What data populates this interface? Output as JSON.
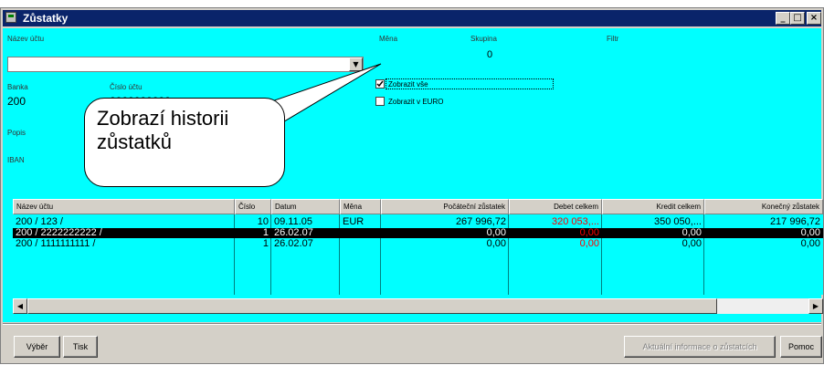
{
  "window": {
    "title": "Zůstatky",
    "controls": {
      "minimize": "_",
      "maximize": "□",
      "close": "×"
    }
  },
  "form": {
    "account_name_label": "Název účtu",
    "account_name_value": "",
    "currency_label": "Měna",
    "group_label": "Skupina",
    "group_value": "0",
    "filter_label": "Filtr",
    "bank_label": "Banka",
    "bank_value": "200",
    "account_number_label": "Číslo účtu",
    "account_number_value": "2222222222",
    "description_label": "Popis",
    "iban_label": "IBAN",
    "show_all_label": "Zobrazit vše",
    "show_all_checked": true,
    "show_euro_label": "Zobrazit v EURO",
    "show_euro_checked": false
  },
  "callout": {
    "text": "Zobrazí historii\nzůstatků"
  },
  "table": {
    "columns": [
      "Název účtu",
      "Číslo",
      "Datum",
      "Měna",
      "Počáteční zůstatek",
      "Debet celkem",
      "Kredit celkem",
      "Konečný zůstatek"
    ],
    "rows": [
      {
        "name": "200 / 123 /",
        "num": "10",
        "date": "09.11.05",
        "currency": "EUR",
        "start": "267 996,72",
        "debit": "320 053,...",
        "credit": "350 050,...",
        "end": "217 996,72",
        "selected": false
      },
      {
        "name": "200 / 2222222222 /",
        "num": "1",
        "date": "26.02.07",
        "currency": "",
        "start": "0,00",
        "debit": "0,00",
        "credit": "0,00",
        "end": "0,00",
        "selected": true
      },
      {
        "name": "200 / 1111111111 /",
        "num": "1",
        "date": "26.02.07",
        "currency": "",
        "start": "0,00",
        "debit": "0,00",
        "credit": "0,00",
        "end": "0,00",
        "selected": false
      }
    ]
  },
  "buttons": {
    "select": "Výběr",
    "print": "Tisk",
    "current_info": "Aktuální informace o zůstatcích",
    "help": "Pomoc"
  },
  "icons": {
    "app": "app-window-icon",
    "combo_arrow": "▼",
    "scroll_left": "◀",
    "scroll_right": "▶"
  }
}
